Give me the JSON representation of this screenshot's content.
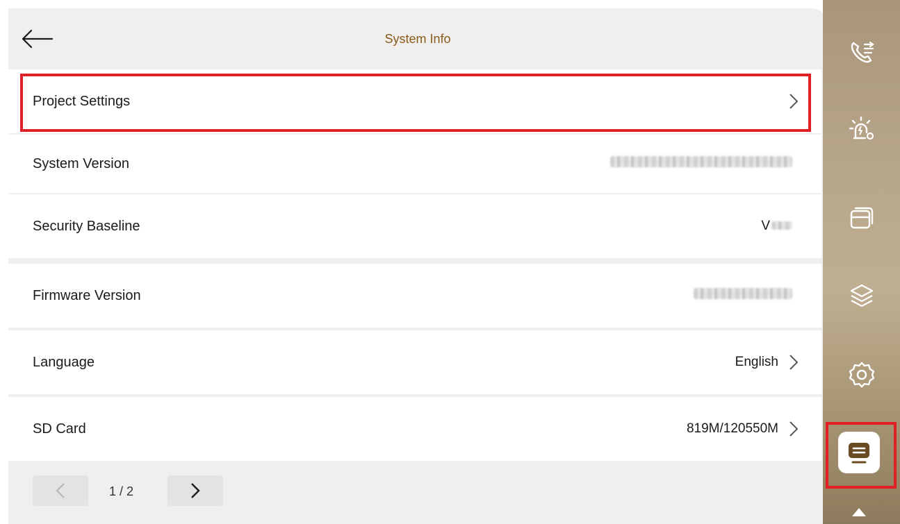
{
  "header": {
    "title": "System Info"
  },
  "rows": [
    {
      "label": "Project Settings",
      "value": ""
    },
    {
      "label": "System Version",
      "value": ""
    },
    {
      "label": "Security Baseline",
      "value": "V"
    },
    {
      "label": "Firmware Version",
      "value": ""
    },
    {
      "label": "Language",
      "value": "English"
    },
    {
      "label": "SD Card",
      "value": "819M/120550M"
    }
  ],
  "pager": {
    "page": "1 / 2"
  },
  "sidebar": {
    "items": [
      {
        "icon": "call-settings-icon"
      },
      {
        "icon": "alarm-settings-icon"
      },
      {
        "icon": "card-icon"
      },
      {
        "icon": "layers-icon"
      },
      {
        "icon": "gear-icon"
      },
      {
        "icon": "system-info-icon",
        "active": true
      }
    ]
  },
  "colors": {
    "accent": "#8a5a1a",
    "highlight": "#e01f26",
    "sidebar": "#b7a58a"
  }
}
